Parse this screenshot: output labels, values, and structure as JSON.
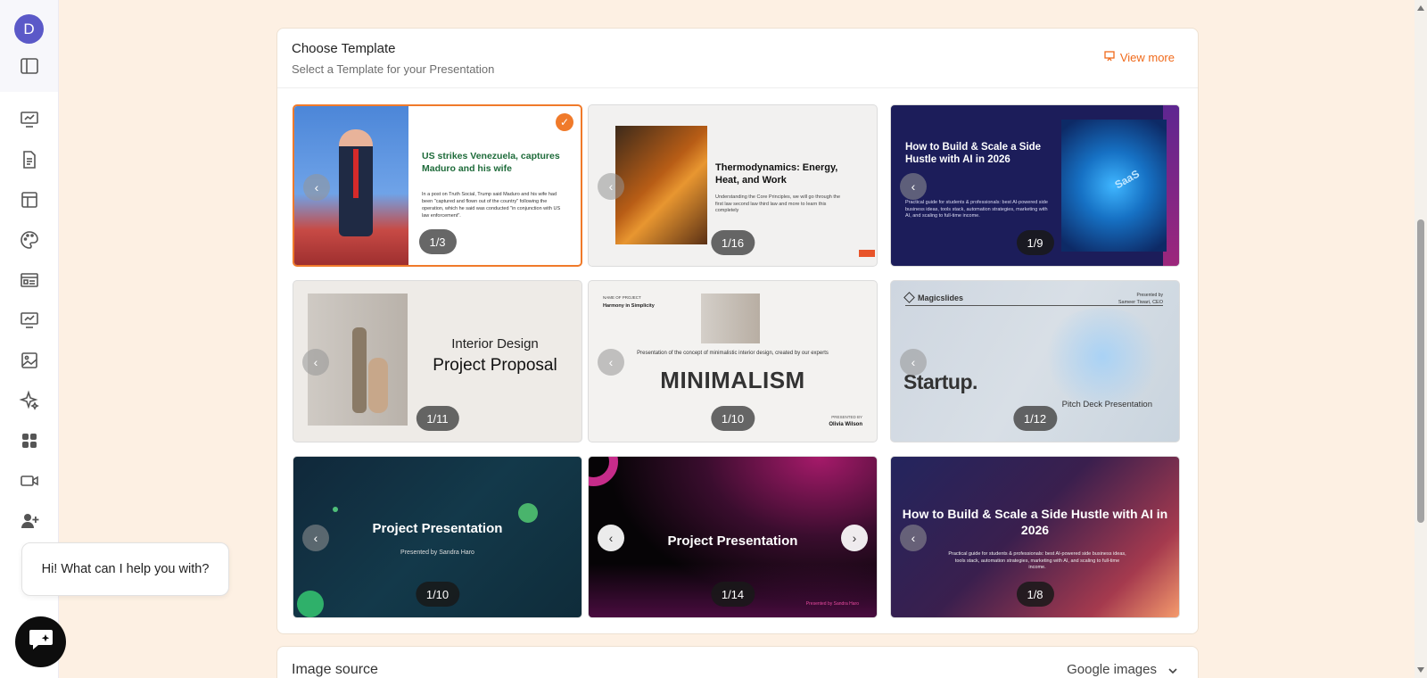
{
  "user": {
    "avatar_initial": "D"
  },
  "sidebar": {
    "icons": [
      "panel-toggle-icon",
      "presentation-icon",
      "document-icon",
      "layout-icon",
      "palette-icon",
      "slides-icon",
      "chart-icon",
      "image-icon",
      "sparkle-icon",
      "apps-icon",
      "video-icon",
      "add-user-icon"
    ]
  },
  "template_section": {
    "title": "Choose Template",
    "subtitle": "Select a Template for your Presentation",
    "view_more": "View more"
  },
  "templates": [
    {
      "counter": "1/3",
      "selected": true,
      "title": "US strikes Venezuela, captures Maduro and his wife",
      "body": "In a post on Truth Social, Trump said Maduro and his wife had been \"captured and flown out of the country\" following the operation, which he said was conducted \"in conjunction with US law enforcement\"."
    },
    {
      "counter": "1/16",
      "title": "Thermodynamics: Energy, Heat, and Work",
      "body": "Understanding the Core Principles, we will go through the first law second law third law and more to learn this completely"
    },
    {
      "counter": "1/9",
      "title": "How to Build & Scale a Side Hustle with AI in 2026",
      "body": "Practical guide for students & professionals: best AI-powered side business ideas, tools stack, automation strategies, marketing with AI, and scaling to full-time income.",
      "image_text": "SaaS"
    },
    {
      "counter": "1/11",
      "subtitle": "Interior Design",
      "title": "Project Proposal"
    },
    {
      "counter": "1/10",
      "label": "NAME OF PROJECT",
      "name": "Harmony in Simplicity",
      "desc": "Presentation of the concept of minimalistic interior design, created by our experts",
      "title": "MINIMALISM",
      "presented_by": "PRESENTED BY",
      "author": "Olivia Wilson"
    },
    {
      "counter": "1/12",
      "logo": "Magicslides",
      "presented_by": "Presented by",
      "presenter": "Sameer Tiwari, CEO",
      "title": "Startup.",
      "subtitle": "Pitch Deck Presentation"
    },
    {
      "counter": "1/10",
      "title": "Project Presentation",
      "subtitle": "Presented by Sandra Haro"
    },
    {
      "counter": "1/14",
      "title": "Project Presentation",
      "presented_by": "Presented by Sandra Haro"
    },
    {
      "counter": "1/8",
      "title": "How to Build & Scale a Side Hustle with AI in 2026",
      "body": "Practical guide for students & professionals: best AI-powered side business ideas, tools stack, automation strategies, marketing with AI, and scaling to full-time income."
    }
  ],
  "image_source": {
    "label": "Image source",
    "value": "Google images"
  },
  "chat": {
    "greeting": "Hi! What can I help you with?"
  },
  "colors": {
    "accent": "#f06a1b",
    "background": "#fdf0e3",
    "avatar": "#5b59c8"
  }
}
